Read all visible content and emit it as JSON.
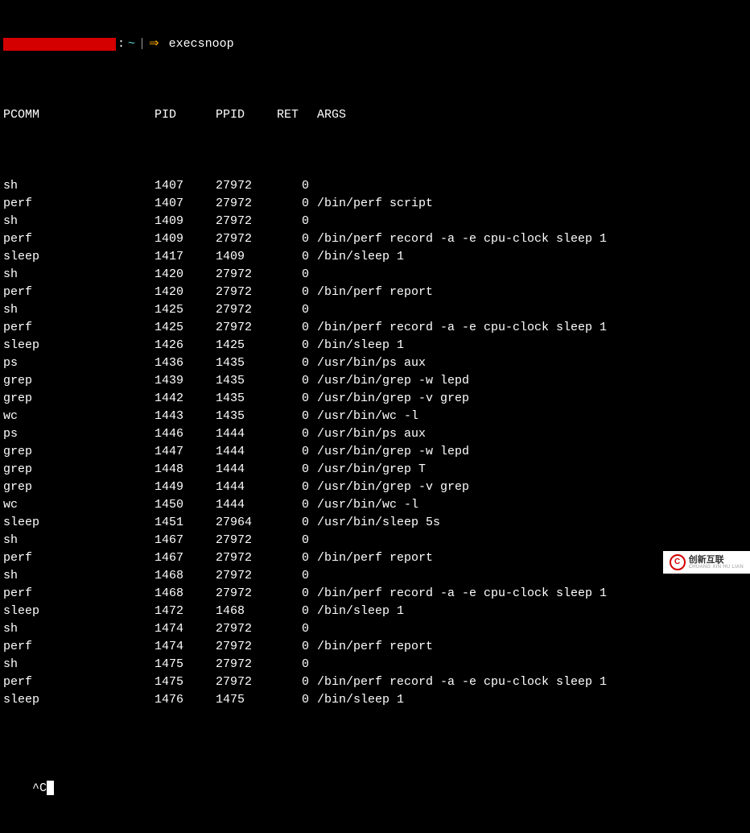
{
  "prompt": {
    "tilde": "~",
    "pipe": "|",
    "arrow": "⇒",
    "command": "execsnoop"
  },
  "header": {
    "pcomm": "PCOMM",
    "pid": "PID",
    "ppid": "PPID",
    "ret": "RET",
    "args": "ARGS"
  },
  "rows": [
    {
      "pcomm": "sh",
      "pid": "1407",
      "ppid": "27972",
      "ret": "0",
      "args": ""
    },
    {
      "pcomm": "perf",
      "pid": "1407",
      "ppid": "27972",
      "ret": "0",
      "args": "/bin/perf script"
    },
    {
      "pcomm": "sh",
      "pid": "1409",
      "ppid": "27972",
      "ret": "0",
      "args": ""
    },
    {
      "pcomm": "perf",
      "pid": "1409",
      "ppid": "27972",
      "ret": "0",
      "args": "/bin/perf record -a -e cpu-clock sleep 1"
    },
    {
      "pcomm": "sleep",
      "pid": "1417",
      "ppid": "1409",
      "ret": "0",
      "args": "/bin/sleep 1"
    },
    {
      "pcomm": "sh",
      "pid": "1420",
      "ppid": "27972",
      "ret": "0",
      "args": ""
    },
    {
      "pcomm": "perf",
      "pid": "1420",
      "ppid": "27972",
      "ret": "0",
      "args": "/bin/perf report"
    },
    {
      "pcomm": "sh",
      "pid": "1425",
      "ppid": "27972",
      "ret": "0",
      "args": ""
    },
    {
      "pcomm": "perf",
      "pid": "1425",
      "ppid": "27972",
      "ret": "0",
      "args": "/bin/perf record -a -e cpu-clock sleep 1"
    },
    {
      "pcomm": "sleep",
      "pid": "1426",
      "ppid": "1425",
      "ret": "0",
      "args": "/bin/sleep 1"
    },
    {
      "pcomm": "ps",
      "pid": "1436",
      "ppid": "1435",
      "ret": "0",
      "args": "/usr/bin/ps aux"
    },
    {
      "pcomm": "grep",
      "pid": "1439",
      "ppid": "1435",
      "ret": "0",
      "args": "/usr/bin/grep -w lepd"
    },
    {
      "pcomm": "grep",
      "pid": "1442",
      "ppid": "1435",
      "ret": "0",
      "args": "/usr/bin/grep -v grep"
    },
    {
      "pcomm": "wc",
      "pid": "1443",
      "ppid": "1435",
      "ret": "0",
      "args": "/usr/bin/wc -l"
    },
    {
      "pcomm": "ps",
      "pid": "1446",
      "ppid": "1444",
      "ret": "0",
      "args": "/usr/bin/ps aux"
    },
    {
      "pcomm": "grep",
      "pid": "1447",
      "ppid": "1444",
      "ret": "0",
      "args": "/usr/bin/grep -w lepd"
    },
    {
      "pcomm": "grep",
      "pid": "1448",
      "ppid": "1444",
      "ret": "0",
      "args": "/usr/bin/grep T"
    },
    {
      "pcomm": "grep",
      "pid": "1449",
      "ppid": "1444",
      "ret": "0",
      "args": "/usr/bin/grep -v grep"
    },
    {
      "pcomm": "wc",
      "pid": "1450",
      "ppid": "1444",
      "ret": "0",
      "args": "/usr/bin/wc -l"
    },
    {
      "pcomm": "sleep",
      "pid": "1451",
      "ppid": "27964",
      "ret": "0",
      "args": "/usr/bin/sleep 5s"
    },
    {
      "pcomm": "sh",
      "pid": "1467",
      "ppid": "27972",
      "ret": "0",
      "args": ""
    },
    {
      "pcomm": "perf",
      "pid": "1467",
      "ppid": "27972",
      "ret": "0",
      "args": "/bin/perf report"
    },
    {
      "pcomm": "sh",
      "pid": "1468",
      "ppid": "27972",
      "ret": "0",
      "args": ""
    },
    {
      "pcomm": "perf",
      "pid": "1468",
      "ppid": "27972",
      "ret": "0",
      "args": "/bin/perf record -a -e cpu-clock sleep 1"
    },
    {
      "pcomm": "sleep",
      "pid": "1472",
      "ppid": "1468",
      "ret": "0",
      "args": "/bin/sleep 1"
    },
    {
      "pcomm": "sh",
      "pid": "1474",
      "ppid": "27972",
      "ret": "0",
      "args": ""
    },
    {
      "pcomm": "perf",
      "pid": "1474",
      "ppid": "27972",
      "ret": "0",
      "args": "/bin/perf report"
    },
    {
      "pcomm": "sh",
      "pid": "1475",
      "ppid": "27972",
      "ret": "0",
      "args": ""
    },
    {
      "pcomm": "perf",
      "pid": "1475",
      "ppid": "27972",
      "ret": "0",
      "args": "/bin/perf record -a -e cpu-clock sleep 1"
    },
    {
      "pcomm": "sleep",
      "pid": "1476",
      "ppid": "1475",
      "ret": "0",
      "args": "/bin/sleep 1"
    }
  ],
  "interrupt": "^C",
  "watermark": {
    "logo": "C",
    "cn": "创新互联",
    "en": "CHUANG XIN HU LIAN"
  }
}
